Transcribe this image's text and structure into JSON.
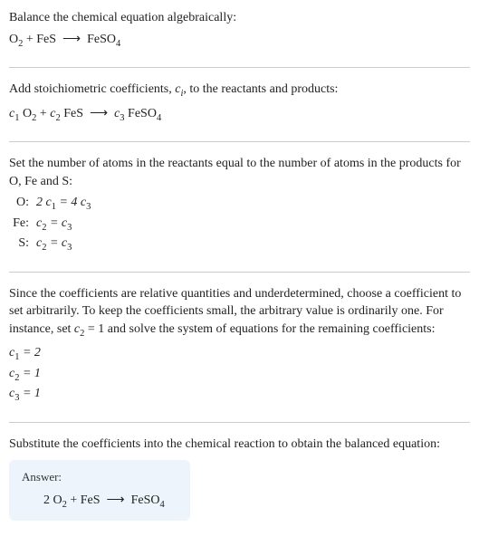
{
  "section1": {
    "title": "Balance the chemical equation algebraically:",
    "eq_html": "O<sub class=\"normal\">2</sub> + FeS &nbsp;⟶&nbsp; FeSO<sub class=\"normal\">4</sub>"
  },
  "section2": {
    "text": "Add stoichiometric coefficients, ",
    "ci_html": "<span class=\"italic\">c<sub>i</sub></span>",
    "text2": ", to the reactants and products:",
    "eq_html": "<span class=\"italic\">c</span><sub class=\"normal\">1</sub> O<sub class=\"normal\">2</sub> + <span class=\"italic\">c</span><sub class=\"normal\">2</sub> FeS &nbsp;⟶&nbsp; <span class=\"italic\">c</span><sub class=\"normal\">3</sub> FeSO<sub class=\"normal\">4</sub>"
  },
  "section3": {
    "text": "Set the number of atoms in the reactants equal to the number of atoms in the products for O, Fe and S:",
    "rows": [
      {
        "label": "O:",
        "eq_html": "2 <span class=\"italic\">c</span><sub class=\"normal\">1</sub> = 4 <span class=\"italic\">c</span><sub class=\"normal\">3</sub>"
      },
      {
        "label": "Fe:",
        "eq_html": "<span class=\"italic\">c</span><sub class=\"normal\">2</sub> = <span class=\"italic\">c</span><sub class=\"normal\">3</sub>"
      },
      {
        "label": "S:",
        "eq_html": "<span class=\"italic\">c</span><sub class=\"normal\">2</sub> = <span class=\"italic\">c</span><sub class=\"normal\">3</sub>"
      }
    ]
  },
  "section4": {
    "text_html": "Since the coefficients are relative quantities and underdetermined, choose a coefficient to set arbitrarily. To keep the coefficients small, the arbitrary value is ordinarily one. For instance, set <span class=\"italic\">c</span><sub class=\"normal\">2</sub> = 1 and solve the system of equations for the remaining coefficients:",
    "solutions": [
      {
        "html": "<span class=\"italic\">c</span><sub class=\"normal\">1</sub> = 2"
      },
      {
        "html": "<span class=\"italic\">c</span><sub class=\"normal\">2</sub> = 1"
      },
      {
        "html": "<span class=\"italic\">c</span><sub class=\"normal\">3</sub> = 1"
      }
    ]
  },
  "section5": {
    "text": "Substitute the coefficients into the chemical reaction to obtain the balanced equation:",
    "answer_label": "Answer:",
    "answer_html": "2 O<sub class=\"normal\">2</sub> + FeS &nbsp;⟶&nbsp; FeSO<sub class=\"normal\">4</sub>"
  }
}
